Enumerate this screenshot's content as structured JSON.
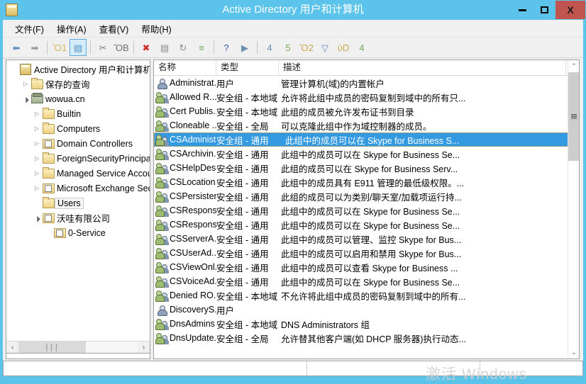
{
  "window": {
    "title": "Active Directory 用户和计算机",
    "icon": "console-icon",
    "accent_color": "#5cc4ea",
    "close_color": "#c0544f",
    "controls": {
      "minimize": "–",
      "maximize": "□",
      "close": "X"
    }
  },
  "menubar": {
    "items": [
      {
        "label": "文件(F)",
        "name": "menu-file"
      },
      {
        "label": "操作(A)",
        "name": "menu-action"
      },
      {
        "label": "查看(V)",
        "name": "menu-view"
      },
      {
        "label": "帮助(H)",
        "name": "menu-help"
      }
    ]
  },
  "toolbar": {
    "buttons": [
      {
        "name": "back-icon",
        "glyph": "⬅",
        "color": "#5b8cc4",
        "active": false
      },
      {
        "name": "forward-icon",
        "glyph": "➡",
        "color": "#9a9a9a",
        "active": false
      },
      {
        "sep": true
      },
      {
        "name": "up-folder-icon",
        "glyph": "Ὄ1",
        "color": "#d8b55c",
        "active": false
      },
      {
        "name": "show-hide-tree-icon",
        "glyph": "▤",
        "color": "#4e8fbf",
        "active": true
      },
      {
        "sep": true
      },
      {
        "name": "cut-icon",
        "glyph": "✂",
        "color": "#7a7a7a",
        "active": false
      },
      {
        "name": "paste-icon",
        "glyph": "ὌB",
        "color": "#6d6d6d",
        "active": false
      },
      {
        "sep": true
      },
      {
        "name": "delete-icon",
        "glyph": "✖",
        "color": "#d0312d",
        "active": false
      },
      {
        "name": "properties-icon",
        "glyph": "▤",
        "color": "#8a8a8a",
        "active": false
      },
      {
        "name": "refresh-icon",
        "glyph": "↻",
        "color": "#8a8a8a",
        "active": false
      },
      {
        "name": "export-list-icon",
        "glyph": "≡",
        "color": "#7aa85a",
        "active": false
      },
      {
        "sep": true
      },
      {
        "name": "help-icon",
        "glyph": "?",
        "color": "#2f5fa8",
        "active": false
      },
      {
        "name": "console-window-icon",
        "glyph": "▶",
        "color": "#6d8fb0",
        "active": false
      },
      {
        "sep": true
      },
      {
        "name": "new-user-icon",
        "glyph": "὆4",
        "color": "#6d8fb0",
        "active": false
      },
      {
        "name": "new-group-icon",
        "glyph": "὆5",
        "color": "#7aa85a",
        "active": false
      },
      {
        "name": "new-ou-icon",
        "glyph": "Ὄ2",
        "color": "#c9a84c",
        "active": false
      },
      {
        "name": "filter-icon",
        "glyph": "▽",
        "color": "#5b8cc4",
        "active": false
      },
      {
        "name": "find-icon",
        "glyph": "ὐD",
        "color": "#c9a84c",
        "active": false
      },
      {
        "name": "saved-query-icon",
        "glyph": "὆4",
        "color": "#7aa85a",
        "active": false
      }
    ]
  },
  "tree": {
    "nodes": [
      {
        "label": "Active Directory 用户和计算机",
        "indent": 0,
        "expander": "none",
        "icon": "console-icon",
        "selected": false
      },
      {
        "label": "保存的查询",
        "indent": 1,
        "expander": "closed",
        "icon": "folder-icon",
        "selected": false
      },
      {
        "label": "wowua.cn",
        "indent": 1,
        "expander": "open",
        "icon": "domain-icon",
        "selected": false
      },
      {
        "label": "Builtin",
        "indent": 2,
        "expander": "closed",
        "icon": "folder-icon",
        "selected": false
      },
      {
        "label": "Computers",
        "indent": 2,
        "expander": "closed",
        "icon": "folder-icon",
        "selected": false
      },
      {
        "label": "Domain Controllers",
        "indent": 2,
        "expander": "closed",
        "icon": "ou-icon",
        "selected": false
      },
      {
        "label": "ForeignSecurityPrincipals",
        "indent": 2,
        "expander": "closed",
        "icon": "folder-icon",
        "selected": false
      },
      {
        "label": "Managed Service Accounts",
        "indent": 2,
        "expander": "closed",
        "icon": "folder-icon",
        "selected": false
      },
      {
        "label": "Microsoft Exchange Security Groups",
        "indent": 2,
        "expander": "closed",
        "icon": "ou-icon",
        "selected": false
      },
      {
        "label": "Users",
        "indent": 2,
        "expander": "none",
        "icon": "folder-icon",
        "selected": true
      },
      {
        "label": "沃哇有限公司",
        "indent": 2,
        "expander": "open",
        "icon": "ou-icon",
        "selected": false
      },
      {
        "label": "0-Service",
        "indent": 3,
        "expander": "none",
        "icon": "ou-icon",
        "selected": false
      }
    ],
    "hscroll": {
      "left_arrow": "‹",
      "right_arrow": "›",
      "grip": "‖‖"
    }
  },
  "list": {
    "columns": [
      {
        "label": "名称",
        "name": "column-name"
      },
      {
        "label": "类型",
        "name": "column-type"
      },
      {
        "label": "描述",
        "name": "column-description"
      }
    ],
    "rows": [
      {
        "name": "Administrat...",
        "type": "用户",
        "desc": "管理计算机(域)的内置帐户",
        "icon": "user-icon",
        "selected": false
      },
      {
        "name": "Allowed R...",
        "type": "安全组 - 本地域",
        "desc": "允许将此组中成员的密码复制到域中的所有只...",
        "icon": "group-icon",
        "selected": false
      },
      {
        "name": "Cert Publis...",
        "type": "安全组 - 本地域",
        "desc": "此组的成员被允许发布证书到目录",
        "icon": "group-icon",
        "selected": false
      },
      {
        "name": "Cloneable ...",
        "type": "安全组 - 全局",
        "desc": "可以克隆此组中作为域控制器的成员。",
        "icon": "group-icon",
        "selected": false
      },
      {
        "name": "CSAdminist...",
        "type": "安全组 - 通用",
        "desc": "此组中的成员可以在 Skype for Business S...",
        "icon": "group-icon",
        "selected": true
      },
      {
        "name": "CSArchivin...",
        "type": "安全组 - 通用",
        "desc": "此组中的成员可以在 Skype for Business Se...",
        "icon": "group-icon",
        "selected": false
      },
      {
        "name": "CSHelpDesk",
        "type": "安全组 - 通用",
        "desc": "此组的成员可以在 Skype for Business Serv...",
        "icon": "group-icon",
        "selected": false
      },
      {
        "name": "CSLocation...",
        "type": "安全组 - 通用",
        "desc": "此组中的成员具有 E911 管理的最低级权限。...",
        "icon": "group-icon",
        "selected": false
      },
      {
        "name": "CSPersisten...",
        "type": "安全组 - 通用",
        "desc": "此组的成员可以为类别/聊天室/加载项运行持...",
        "icon": "group-icon",
        "selected": false
      },
      {
        "name": "CSRespons...",
        "type": "安全组 - 通用",
        "desc": "此组中的成员可以在 Skype for Business Se...",
        "icon": "group-icon",
        "selected": false
      },
      {
        "name": "CSRespons...",
        "type": "安全组 - 通用",
        "desc": "此组中的成员可以在 Skype for Business Se...",
        "icon": "group-icon",
        "selected": false
      },
      {
        "name": "CSServerA...",
        "type": "安全组 - 通用",
        "desc": "此组中的成员可以管理、监控 Skype for Bus...",
        "icon": "group-icon",
        "selected": false
      },
      {
        "name": "CSUserAd...",
        "type": "安全组 - 通用",
        "desc": "此组中的成员可以启用和禁用 Skype for Bus...",
        "icon": "group-icon",
        "selected": false
      },
      {
        "name": "CSViewOnl...",
        "type": "安全组 - 通用",
        "desc": "此组中的成员可以查看 Skype for Business ...",
        "icon": "group-icon",
        "selected": false
      },
      {
        "name": "CSVoiceAd...",
        "type": "安全组 - 通用",
        "desc": "此组中的成员可以在 Skype for Business Se...",
        "icon": "group-icon",
        "selected": false
      },
      {
        "name": "Denied RO...",
        "type": "安全组 - 本地域",
        "desc": "不允许将此组中成员的密码复制到域中的所有...",
        "icon": "group-icon",
        "selected": false
      },
      {
        "name": "DiscoveryS...",
        "type": "用户",
        "desc": "",
        "icon": "user-icon",
        "selected": false
      },
      {
        "name": "DnsAdmins",
        "type": "安全组 - 本地域",
        "desc": "DNS Administrators 组",
        "icon": "group-icon",
        "selected": false
      },
      {
        "name": "DnsUpdate...",
        "type": "安全组 - 全局",
        "desc": "允许替其他客户端(如 DHCP 服务器)执行动态...",
        "icon": "group-icon",
        "selected": false
      }
    ],
    "vscroll": {
      "up_arrow": "⌃",
      "down_arrow": "⌄"
    }
  },
  "statusbar": {
    "cell1": "",
    "cell2": "",
    "cell3": ""
  },
  "watermark": {
    "text": "激活 Windows"
  }
}
